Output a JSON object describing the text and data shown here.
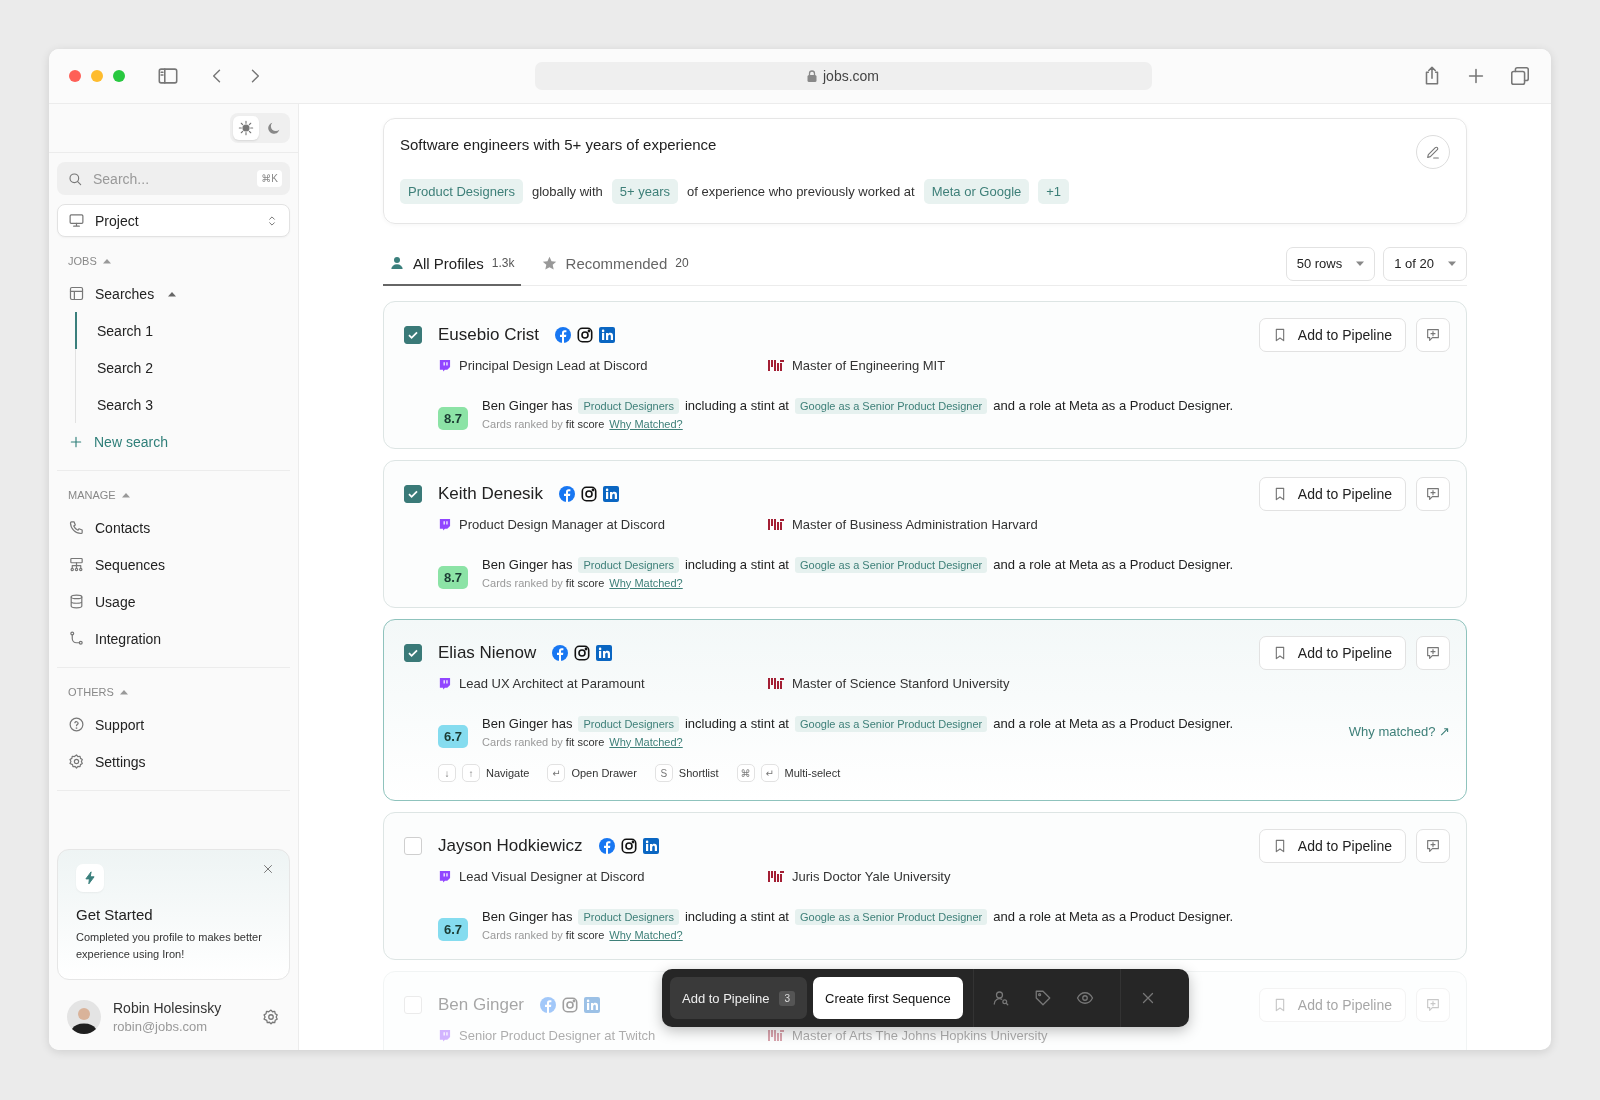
{
  "browser": {
    "url": "jobs.com"
  },
  "sidebar": {
    "theme": [
      {
        "kind": "light",
        "selected": true
      },
      {
        "kind": "dark",
        "selected": false
      }
    ],
    "search": {
      "placeholder": "Search...",
      "shortcut": "⌘K"
    },
    "project": "Project",
    "sections": [
      {
        "title": "JOBS",
        "expanded": true,
        "items": [
          {
            "label": "Searches",
            "expanded": true,
            "children": [
              {
                "label": "Search 1",
                "selected": true
              },
              {
                "label": "Search 2",
                "selected": false
              },
              {
                "label": "Search 3",
                "selected": false
              }
            ]
          }
        ],
        "action": "New search"
      },
      {
        "title": "MANAGE",
        "expanded": true,
        "items": [
          {
            "label": "Contacts"
          },
          {
            "label": "Sequences"
          },
          {
            "label": "Usage"
          },
          {
            "label": "Integration"
          }
        ]
      },
      {
        "title": "OTHERS",
        "expanded": true,
        "items": [
          {
            "label": "Support"
          },
          {
            "label": "Settings"
          }
        ]
      }
    ],
    "promo": {
      "title": "Get Started",
      "text": "Completed you profile to makes better experience using Iron!"
    },
    "user": {
      "name": "Robin Holesinsky",
      "email": "robin@jobs.com"
    }
  },
  "query": {
    "text": "Software engineers with 5+ years of experience",
    "parts": [
      {
        "kind": "tag",
        "text": "Product Designers"
      },
      {
        "kind": "text",
        "text": "globally with"
      },
      {
        "kind": "tag",
        "text": "5+ years"
      },
      {
        "kind": "text",
        "text": "of experience who previously worked at"
      },
      {
        "kind": "tag",
        "text": "Meta or Google"
      },
      {
        "kind": "tag",
        "text": "+1"
      }
    ]
  },
  "tabs": [
    {
      "label": "All Profiles",
      "count": "1.3k",
      "selected": true
    },
    {
      "label": "Recommended",
      "count": "20",
      "selected": false
    }
  ],
  "pager": {
    "rows": "50 rows",
    "page": "1 of 20"
  },
  "profiles": [
    {
      "name": "Eusebio Crist",
      "checked": true,
      "focused": false,
      "dimmed": false,
      "role": "Principal Design Lead at Discord",
      "education": "Master of Engineering MIT",
      "button": "Add to Pipeline",
      "score": "8.7",
      "color": "#8ce3a6",
      "summary": [
        {
          "kind": "text",
          "text": "Ben Ginger has"
        },
        {
          "kind": "tag",
          "text": "Product Designers"
        },
        {
          "kind": "text",
          "text": "including a stint at"
        },
        {
          "kind": "tag",
          "text": "Google as a Senior Product Designer"
        },
        {
          "kind": "text",
          "text": "and a role at Meta as a Product Designer."
        }
      ],
      "caption": "Cards ranked by **fit score**",
      "link": "Why Matched?"
    },
    {
      "name": "Keith Denesik",
      "checked": true,
      "focused": false,
      "dimmed": false,
      "role": "Product Design Manager at Discord",
      "education": "Master of Business Administration Harvard",
      "button": "Add to Pipeline",
      "score": "8.7",
      "color": "#8ce3a6",
      "summary": [
        {
          "kind": "text",
          "text": "Ben Ginger has"
        },
        {
          "kind": "tag",
          "text": "Product Designers"
        },
        {
          "kind": "text",
          "text": "including a stint at"
        },
        {
          "kind": "tag",
          "text": "Google as a Senior Product Designer"
        },
        {
          "kind": "text",
          "text": "and a role at Meta as a Product Designer."
        }
      ],
      "caption": "Cards ranked by **fit score**",
      "link": "Why Matched?"
    },
    {
      "name": "Elias Nienow",
      "checked": true,
      "focused": true,
      "dimmed": false,
      "role": "Lead UX Architect at Paramount",
      "education": "Master of Science Stanford University",
      "button": "Add to Pipeline",
      "score": "6.7",
      "color": "#85dcef",
      "summary": [
        {
          "kind": "text",
          "text": "Ben Ginger has"
        },
        {
          "kind": "tag",
          "text": "Product Designers"
        },
        {
          "kind": "text",
          "text": "including a stint at"
        },
        {
          "kind": "tag",
          "text": "Google as a Senior Product Designer"
        },
        {
          "kind": "text",
          "text": "and a role at Meta as a Product Designer."
        }
      ],
      "caption": "Cards ranked by **fit score**",
      "link": "Why Matched?",
      "why_link": "Why matched? ↗",
      "shortcuts": [
        {
          "keys": [
            "↓",
            "↑"
          ],
          "label": "Navigate"
        },
        {
          "keys": [
            "↵"
          ],
          "label": "Open Drawer"
        },
        {
          "keys": [
            "S"
          ],
          "label": "Shortlist"
        },
        {
          "keys": [
            "⌘",
            "↵"
          ],
          "label": "Multi-select"
        }
      ]
    },
    {
      "name": "Jayson Hodkiewicz",
      "checked": false,
      "focused": false,
      "dimmed": false,
      "role": "Lead Visual Designer at Discord",
      "education": "Juris Doctor Yale University",
      "button": "Add to Pipeline",
      "score": "6.7",
      "color": "#85dcef",
      "summary": [
        {
          "kind": "text",
          "text": "Ben Ginger has"
        },
        {
          "kind": "tag",
          "text": "Product Designers"
        },
        {
          "kind": "text",
          "text": "including a stint at"
        },
        {
          "kind": "tag",
          "text": "Google as a Senior Product Designer"
        },
        {
          "kind": "text",
          "text": "and a role at Meta as a Product Designer."
        }
      ],
      "caption": "Cards ranked by **fit score**",
      "link": "Why Matched?"
    },
    {
      "name": "Ben Ginger",
      "checked": false,
      "focused": false,
      "dimmed": true,
      "role": "Senior Product Designer at Twitch",
      "education": "Master of Arts The Johns Hopkins University",
      "button": "Add to Pipeline"
    }
  ],
  "action_bar": {
    "primary": {
      "label": "Add to Pipeline",
      "count": "3"
    },
    "secondary": "Create first Sequence"
  }
}
